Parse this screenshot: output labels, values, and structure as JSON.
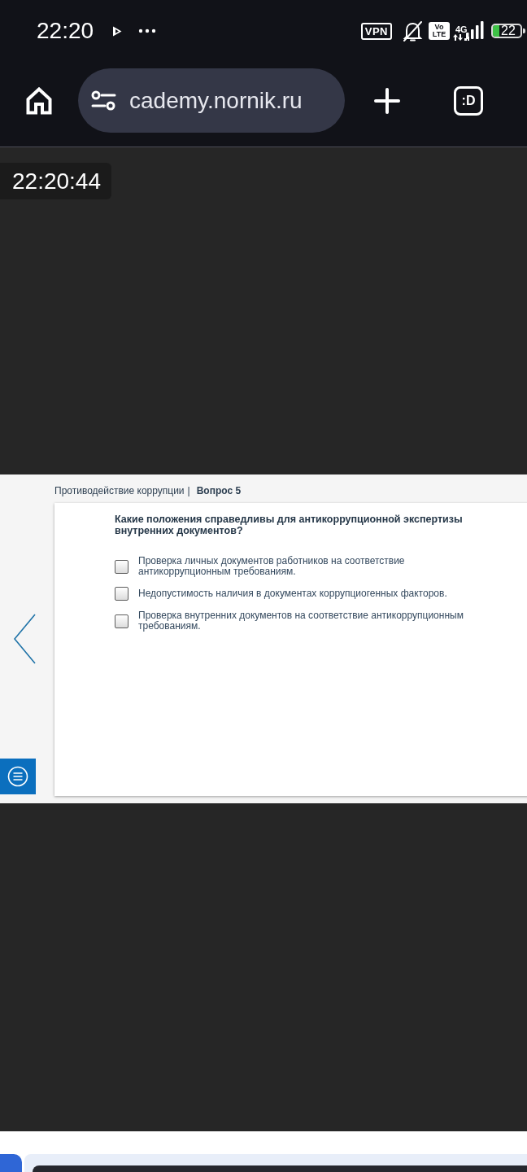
{
  "status_bar": {
    "time": "22:20",
    "vpn": "VPN",
    "volte": "Vo LTE",
    "network": "4G",
    "battery": "22"
  },
  "browser_bar": {
    "url": "cademy.nornik.ru",
    "tab_count": ":D"
  },
  "video": {
    "timestamp": "22:20:44"
  },
  "quiz": {
    "breadcrumb": {
      "course": "Противодействие коррупции",
      "separator": "|",
      "question_number": "Вопрос 5"
    },
    "question": "Какие положения справедливы для антикоррупционной экспертизы внутренних документов?",
    "options": [
      {
        "text": "Проверка личных документов работников на соответствие антикоррупционным требованиям.",
        "checked": false
      },
      {
        "text": "Недопустимость наличия в документах коррупциогенных факторов.",
        "checked": false
      },
      {
        "text": "Проверка внутренних документов на соответствие антикоррупционным требованиям.",
        "checked": false
      }
    ]
  }
}
